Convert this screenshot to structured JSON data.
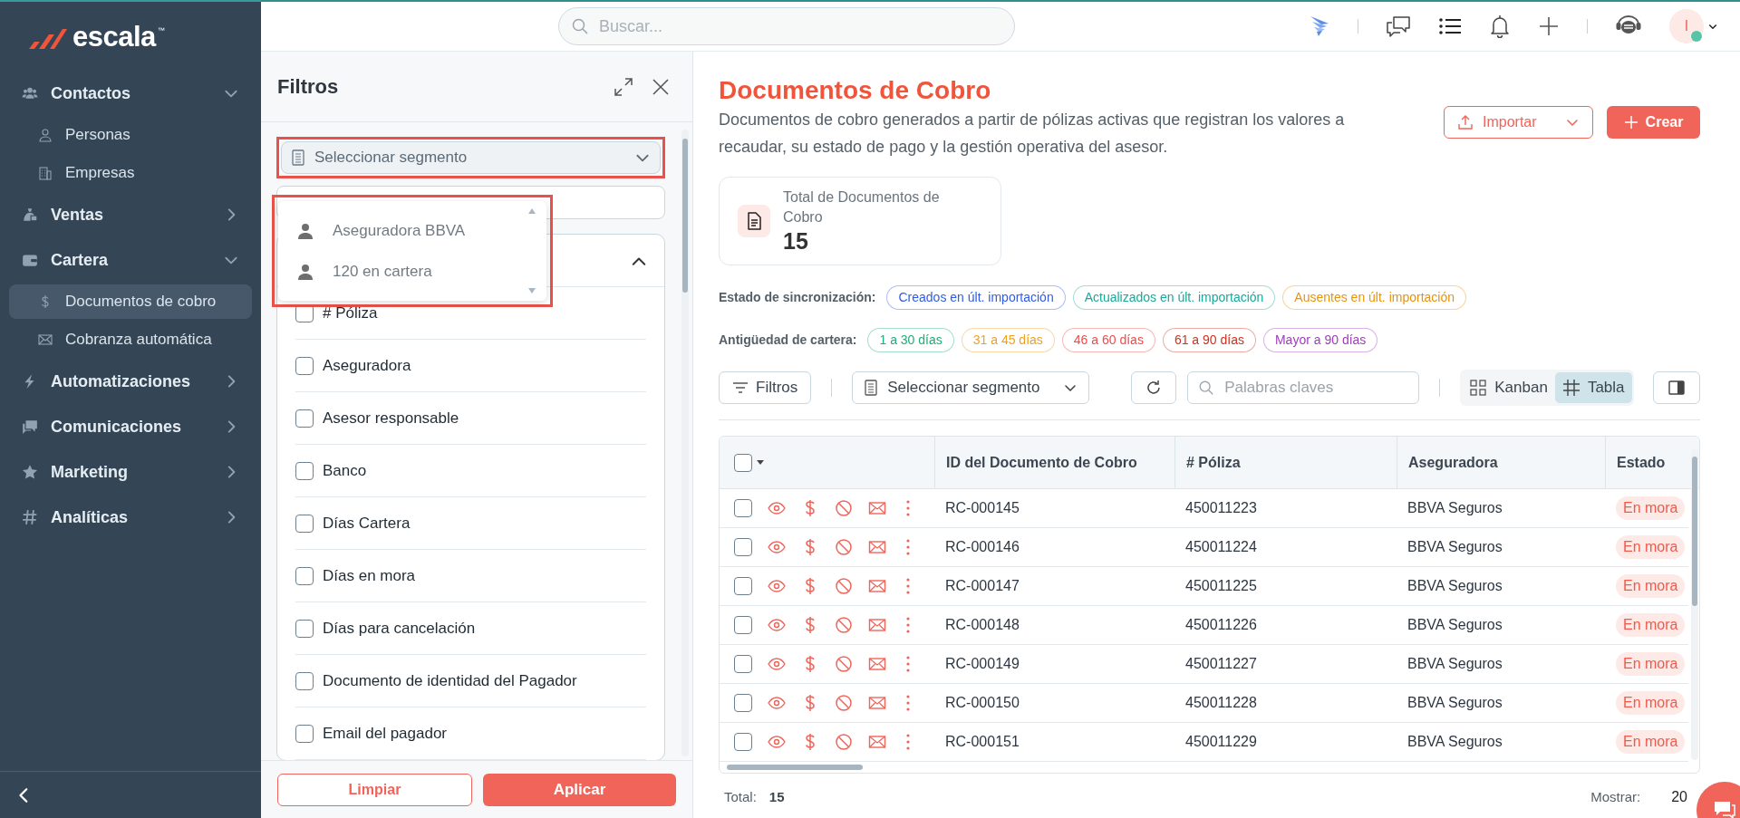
{
  "sidebar": {
    "logo": {
      "word": "escala",
      "mark": "™"
    },
    "items": [
      {
        "label": "Contactos",
        "expanded": true,
        "children": [
          {
            "label": "Personas",
            "selected": false
          },
          {
            "label": "Empresas",
            "selected": false
          }
        ]
      },
      {
        "label": "Ventas",
        "expanded": false
      },
      {
        "label": "Cartera",
        "expanded": true,
        "children": [
          {
            "label": "Documentos de cobro",
            "selected": true
          },
          {
            "label": "Cobranza automática",
            "selected": false
          }
        ]
      },
      {
        "label": "Automatizaciones",
        "expanded": false
      },
      {
        "label": "Comunicaciones",
        "expanded": false
      },
      {
        "label": "Marketing",
        "expanded": false
      },
      {
        "label": "Analíticas",
        "expanded": false
      }
    ]
  },
  "header": {
    "search_placeholder": "Buscar...",
    "avatar_initial": "I"
  },
  "filters": {
    "title": "Filtros",
    "segment_placeholder": "Seleccionar segmento",
    "segment_options": [
      "Aseguradora BBVA",
      "120 en cartera"
    ],
    "group_expanded": true,
    "fields": [
      {
        "label": "# Póliza",
        "checked": false
      },
      {
        "label": "Aseguradora",
        "checked": false
      },
      {
        "label": "Asesor responsable",
        "checked": false
      },
      {
        "label": "Banco",
        "checked": false
      },
      {
        "label": "Días Cartera",
        "checked": false
      },
      {
        "label": "Días en mora",
        "checked": false
      },
      {
        "label": "Días para cancelación",
        "checked": false
      },
      {
        "label": "Documento de identidad del Pagador",
        "checked": false
      },
      {
        "label": "Email del pagador",
        "checked": false
      }
    ],
    "buttons": {
      "clear": "Limpiar",
      "apply": "Aplicar"
    }
  },
  "main": {
    "title": "Documentos de Cobro",
    "description": "Documentos de cobro generados a partir de pólizas activas que registran los valores a recaudar, su estado de pago y la gestión operativa del asesor.",
    "import_button": "Importar",
    "create_button": "Crear",
    "stat": {
      "label": "Total de Documentos de Cobro",
      "value": "15"
    },
    "sync": {
      "label": "Estado de sincronización:",
      "chips": [
        {
          "label": "Creados en últ. importación",
          "color": "#2f5bea"
        },
        {
          "label": "Actualizados en últ. importación",
          "color": "#1aa89a"
        },
        {
          "label": "Ausentes en últ. importación",
          "color": "#e8930c"
        }
      ]
    },
    "aging": {
      "label": "Antigüedad de cartera:",
      "chips": [
        {
          "label": "1 a 30 días",
          "color": "#1fae78"
        },
        {
          "label": "31 a 45 días",
          "color": "#f0a020"
        },
        {
          "label": "46 a 60 días",
          "color": "#ee4c4c"
        },
        {
          "label": "61 a 90 días",
          "color": "#d4301c"
        },
        {
          "label": "Mayor a 90 días",
          "color": "#a03cbc"
        }
      ]
    },
    "toolbar": {
      "filters_button": "Filtros",
      "segment_placeholder": "Seleccionar segmento",
      "search_placeholder": "Palabras claves",
      "views": [
        {
          "label": "Kanban",
          "selected": false
        },
        {
          "label": "Tabla",
          "selected": true
        }
      ]
    },
    "table": {
      "select_all_checked": false,
      "columns": [
        "ID del Documento de Cobro",
        "# Póliza",
        "Aseguradora",
        "Estado"
      ],
      "rows": [
        {
          "checked": false,
          "id": "RC-000145",
          "poliza": "450011223",
          "aseguradora": "BBVA Seguros",
          "estado": "En mora"
        },
        {
          "checked": false,
          "id": "RC-000146",
          "poliza": "450011224",
          "aseguradora": "BBVA Seguros",
          "estado": "En mora"
        },
        {
          "checked": false,
          "id": "RC-000147",
          "poliza": "450011225",
          "aseguradora": "BBVA Seguros",
          "estado": "En mora"
        },
        {
          "checked": false,
          "id": "RC-000148",
          "poliza": "450011226",
          "aseguradora": "BBVA Seguros",
          "estado": "En mora"
        },
        {
          "checked": false,
          "id": "RC-000149",
          "poliza": "450011227",
          "aseguradora": "BBVA Seguros",
          "estado": "En mora"
        },
        {
          "checked": false,
          "id": "RC-000150",
          "poliza": "450011228",
          "aseguradora": "BBVA Seguros",
          "estado": "En mora"
        },
        {
          "checked": false,
          "id": "RC-000151",
          "poliza": "450011229",
          "aseguradora": "BBVA Seguros",
          "estado": "En mora"
        }
      ]
    },
    "footer": {
      "total_label": "Total:",
      "total_value": "15",
      "show_label": "Mostrar:",
      "show_value": "20"
    }
  }
}
